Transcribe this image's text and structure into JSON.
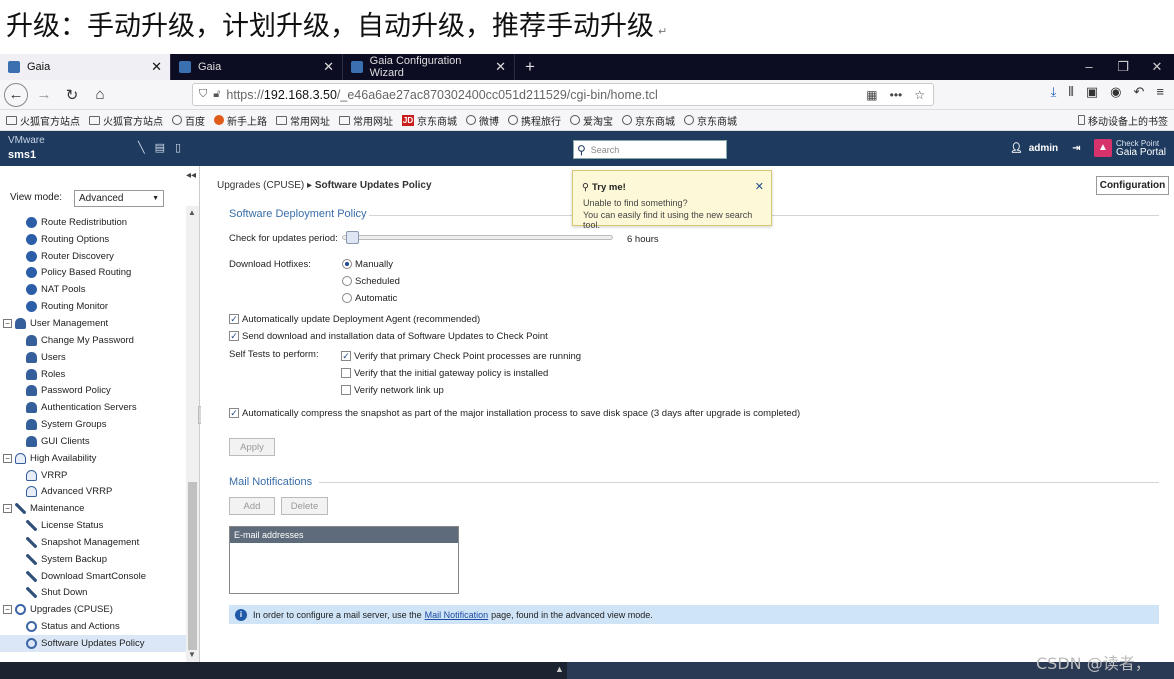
{
  "caption": {
    "text": "升级：手动升级，计划升级，自动升级，推荐手动升级",
    "return_mark": "↵"
  },
  "browser": {
    "tabs": [
      {
        "label": "Gaia"
      },
      {
        "label": "Gaia"
      },
      {
        "label": "Gaia Configuration Wizard"
      }
    ],
    "url": {
      "prefix": "https://",
      "host": "192.168.3.50",
      "path": "/_e46a6ae27ac870302400cc051d211529/cgi-bin/home.tcl"
    },
    "bookmarks": [
      "火狐官方站点",
      "火狐官方站点",
      "百度",
      "新手上路",
      "常用网址",
      "常用网址",
      "京东商城",
      "微博",
      "携程旅行",
      "爱淘宝",
      "京东商城",
      "京东商城"
    ],
    "bookmarks_right": "移动设备上的书签"
  },
  "gaia": {
    "vm_label": "VMware",
    "hostname": "sms1",
    "search_placeholder": "Search",
    "user": "admin",
    "logo_line1": "Check Point",
    "logo_line2": "Gaia Portal"
  },
  "sidebar": {
    "view_mode_label": "View mode:",
    "view_mode_value": "Advanced",
    "items": [
      {
        "label": "Route Redistribution",
        "type": "child",
        "icon": "route"
      },
      {
        "label": "Routing Options",
        "type": "child",
        "icon": "route"
      },
      {
        "label": "Router Discovery",
        "type": "child",
        "icon": "route"
      },
      {
        "label": "Policy Based Routing",
        "type": "child",
        "icon": "route"
      },
      {
        "label": "NAT Pools",
        "type": "child",
        "icon": "route"
      },
      {
        "label": "Routing Monitor",
        "type": "child",
        "icon": "route"
      },
      {
        "label": "User Management",
        "type": "group",
        "icon": "user"
      },
      {
        "label": "Change My Password",
        "type": "child",
        "icon": "user"
      },
      {
        "label": "Users",
        "type": "child",
        "icon": "user"
      },
      {
        "label": "Roles",
        "type": "child",
        "icon": "user"
      },
      {
        "label": "Password Policy",
        "type": "child",
        "icon": "user"
      },
      {
        "label": "Authentication Servers",
        "type": "child",
        "icon": "user"
      },
      {
        "label": "System Groups",
        "type": "child",
        "icon": "user"
      },
      {
        "label": "GUI Clients",
        "type": "child",
        "icon": "user"
      },
      {
        "label": "High Availability",
        "type": "group",
        "icon": "ha"
      },
      {
        "label": "VRRP",
        "type": "child",
        "icon": "ha"
      },
      {
        "label": "Advanced VRRP",
        "type": "child",
        "icon": "ha"
      },
      {
        "label": "Maintenance",
        "type": "group",
        "icon": "wrench"
      },
      {
        "label": "License Status",
        "type": "child",
        "icon": "wrench"
      },
      {
        "label": "Snapshot Management",
        "type": "child",
        "icon": "wrench"
      },
      {
        "label": "System Backup",
        "type": "child",
        "icon": "wrench"
      },
      {
        "label": "Download SmartConsole",
        "type": "child",
        "icon": "wrench"
      },
      {
        "label": "Shut Down",
        "type": "child",
        "icon": "wrench"
      },
      {
        "label": "Upgrades (CPUSE)",
        "type": "group",
        "icon": "cycle"
      },
      {
        "label": "Status and Actions",
        "type": "child",
        "icon": "cycle"
      },
      {
        "label": "Software Updates Policy",
        "type": "child",
        "icon": "cycle",
        "selected": true
      }
    ]
  },
  "main": {
    "breadcrumb_parent": "Upgrades (CPUSE)",
    "breadcrumb_current": "Software Updates Policy",
    "configuration_button": "Configuration",
    "deploy_title": "Software Deployment Policy",
    "check_period_label": "Check for updates period:",
    "check_period_value": "6 hours",
    "check_period_position": 0.02,
    "download_label": "Download Hotfixes:",
    "download_options": [
      "Manually",
      "Scheduled",
      "Automatic"
    ],
    "download_selected": "Manually",
    "auto_update_agent": {
      "label": "Automatically update Deployment Agent (recommended)",
      "checked": true
    },
    "send_data": {
      "label": "Send download and installation data of Software Updates to Check Point",
      "checked": true
    },
    "self_tests_label": "Self Tests to perform:",
    "self_tests": [
      {
        "label": "Verify that primary Check Point processes are running",
        "checked": true
      },
      {
        "label": "Verify that the initial gateway policy is installed",
        "checked": false
      },
      {
        "label": "Verify network link up",
        "checked": false
      }
    ],
    "compress": {
      "label": "Automatically compress the snapshot as part of the major installation process to save disk space (3 days after upgrade is completed)",
      "checked": true
    },
    "apply_button": "Apply",
    "mail_title": "Mail Notifications",
    "add_button": "Add",
    "delete_button": "Delete",
    "mail_column": "E-mail addresses",
    "info_prefix": "In order to configure a mail server, use the",
    "info_link": "Mail Notification",
    "info_suffix": "page, found in the advanced view mode."
  },
  "popup": {
    "title": "Try me!",
    "line1": "Unable to find something?",
    "line2": "You can easily find it using the new search tool."
  },
  "watermark": "CSDN @读者，"
}
